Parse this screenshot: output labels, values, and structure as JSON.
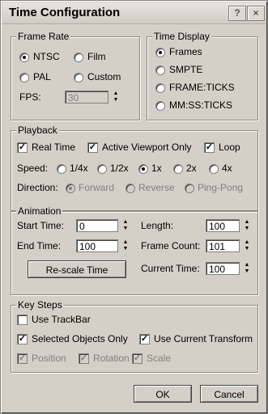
{
  "window": {
    "title": "Time Configuration",
    "help_label": "?",
    "close_label": "×"
  },
  "frame_rate": {
    "legend": "Frame Rate",
    "ntsc": "NTSC",
    "film": "Film",
    "pal": "PAL",
    "custom": "Custom",
    "fps_label": "FPS:",
    "fps_value": "30",
    "selected": "NTSC"
  },
  "time_display": {
    "legend": "Time Display",
    "frames": "Frames",
    "smpte": "SMPTE",
    "frame_ticks": "FRAME:TICKS",
    "mmss_ticks": "MM:SS:TICKS",
    "selected": "Frames"
  },
  "playback": {
    "legend": "Playback",
    "real_time": "Real Time",
    "active_viewport_only": "Active Viewport Only",
    "loop": "Loop",
    "speed_label": "Speed:",
    "speeds": [
      "1/4x",
      "1/2x",
      "1x",
      "2x",
      "4x"
    ],
    "selected_speed": "1x",
    "direction_label": "Direction:",
    "forward": "Forward",
    "reverse": "Reverse",
    "ping_pong": "Ping-Pong"
  },
  "animation": {
    "legend": "Animation",
    "start_time_label": "Start Time:",
    "start_time": "0",
    "end_time_label": "End Time:",
    "end_time": "100",
    "length_label": "Length:",
    "length": "100",
    "frame_count_label": "Frame Count:",
    "frame_count": "101",
    "current_time_label": "Current Time:",
    "current_time": "100",
    "rescale_label": "Re-scale Time"
  },
  "key_steps": {
    "legend": "Key Steps",
    "use_trackbar": "Use TrackBar",
    "selected_objects_only": "Selected Objects Only",
    "use_current_transform": "Use Current Transform",
    "position": "Position",
    "rotation": "Rotation",
    "scale": "Scale"
  },
  "footer": {
    "ok_label": "OK",
    "cancel_label": "Cancel"
  }
}
